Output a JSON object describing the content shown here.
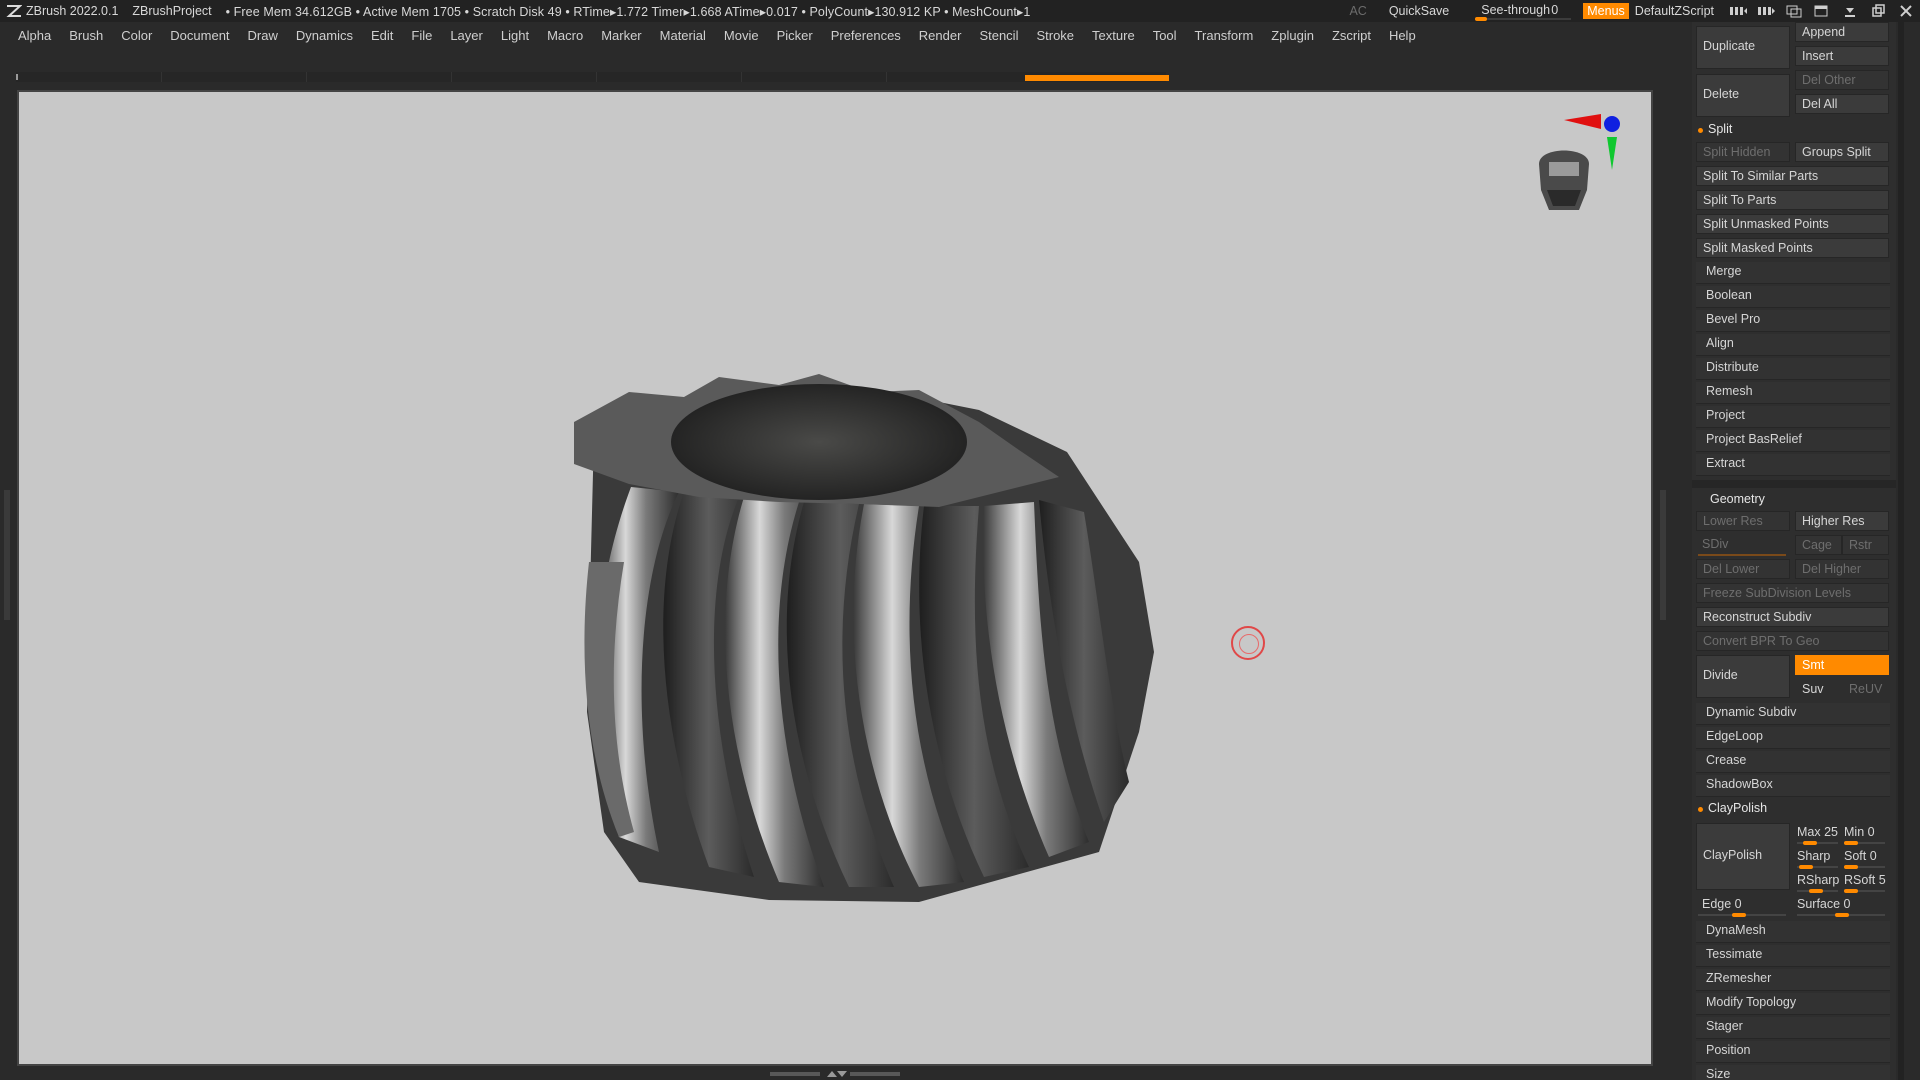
{
  "titlebar": {
    "app_title": "ZBrush 2022.0.1",
    "project": "ZBrushProject",
    "stats": "• Free Mem 34.612GB • Active Mem 1705 • Scratch Disk 49 • RTime▸1.772 Timer▸1.668 ATime▸0.017 • PolyCount▸130.912 KP • MeshCount▸1",
    "ac_label": "AC",
    "quicksave": "QuickSave",
    "seethrough_label": "See-through",
    "seethrough_value": "0",
    "menus_label": "Menus",
    "default_script": "DefaultZScript"
  },
  "menubar": {
    "items": [
      "Alpha",
      "Brush",
      "Color",
      "Document",
      "Draw",
      "Dynamics",
      "Edit",
      "File",
      "Layer",
      "Light",
      "Macro",
      "Marker",
      "Material",
      "Movie",
      "Picker",
      "Preferences",
      "Render",
      "Stencil",
      "Stroke",
      "Texture",
      "Tool",
      "Transform",
      "Zplugin",
      "Zscript",
      "Help"
    ]
  },
  "panel": {
    "subtool_buttons": {
      "duplicate": "Duplicate",
      "append": "Append",
      "insert": "Insert",
      "delete": "Delete",
      "del_other": "Del Other",
      "del_all": "Del All"
    },
    "split": {
      "header": "Split",
      "split_hidden": "Split Hidden",
      "groups_split": "Groups Split",
      "items": [
        "Split To Similar Parts",
        "Split To Parts",
        "Split Unmasked Points",
        "Split Masked Points"
      ]
    },
    "subtool_items": [
      "Merge",
      "Boolean",
      "Bevel Pro",
      "Align",
      "Distribute",
      "Remesh",
      "Project",
      "Project BasRelief",
      "Extract"
    ],
    "geometry": {
      "header": "Geometry",
      "lower_res": "Lower Res",
      "higher_res": "Higher Res",
      "sdiv": "SDiv",
      "cage": "Cage",
      "rstr": "Rstr",
      "del_lower": "Del Lower",
      "del_higher": "Del Higher",
      "freeze": "Freeze SubDivision Levels",
      "reconstruct": "Reconstruct Subdiv",
      "convert_bpr": "Convert BPR To Geo",
      "divide": "Divide",
      "smt": "Smt",
      "suv": "Suv",
      "reuv": "ReUV",
      "items_a": [
        "Dynamic Subdiv",
        "EdgeLoop",
        "Crease",
        "ShadowBox"
      ]
    },
    "claypolish": {
      "header": "ClayPolish",
      "button": "ClayPolish",
      "max": "Max 25",
      "min": "Min 0",
      "sharp": "Sharp",
      "soft": "Soft 0",
      "rsharp": "RSharp",
      "rsoft": "RSoft 5",
      "edge": "Edge 0",
      "surface": "Surface 0"
    },
    "items_b": [
      "DynaMesh",
      "Tessimate",
      "ZRemesher",
      "Modify Topology",
      "Stager",
      "Position",
      "Size"
    ]
  },
  "colors": {
    "accent": "#ff8a00",
    "canvas_bg": "#c8c8c8",
    "panel_bg": "#2e2e2e"
  },
  "icons": [
    "zbrush-logo-icon",
    "shelf-left-icon",
    "shelf-right-icon",
    "layout-icon",
    "window-icon",
    "minimize-icon",
    "restore-icon",
    "close-icon",
    "navigation-gizmo-icon",
    "head-gizmo-icon",
    "brush-cursor-icon"
  ]
}
